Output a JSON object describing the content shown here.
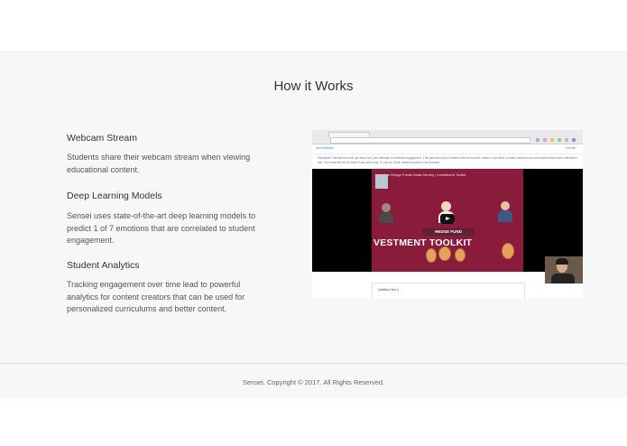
{
  "section": {
    "title": "How it Works",
    "features": [
      {
        "title": "Webcam Stream",
        "text": "Students share their webcam stream when viewing educational content."
      },
      {
        "title": "Deep Learning Models",
        "text": "Sensei uses state-of-the-art deep learning models to predict 1 of 7 emotions that are correlated to student engagement."
      },
      {
        "title": "Student Analytics",
        "text": "Tracking engagement over time lead to powerful analytics for content creators that can be used for personalized curriculums and better content."
      }
    ]
  },
  "screenshot": {
    "site_logo": "senseilearn",
    "nav_link": "Home",
    "disclaimer": "Disclaimer: SenseiLearn will use data from your webcam to estimate engagement. This data will only be shared with the content creator in an effort to make content more personalized and more relevant to you. Your data will not be used in any other way. To opt out, block camera access in the browser.",
    "video_title": "How Hedge Funds Make Money | Investment Toolkit",
    "hedge_label": "HEDGE FUND",
    "toolkit_caption": "VESTMENT TOOLKIT",
    "notes_title": "Untitled No.1",
    "colors": {
      "video_bg": "#8a1b3a",
      "link": "#3a8ee6"
    }
  },
  "footer": {
    "copyright": "Sensei. Copyright © 2017. All Rights Reserved."
  }
}
